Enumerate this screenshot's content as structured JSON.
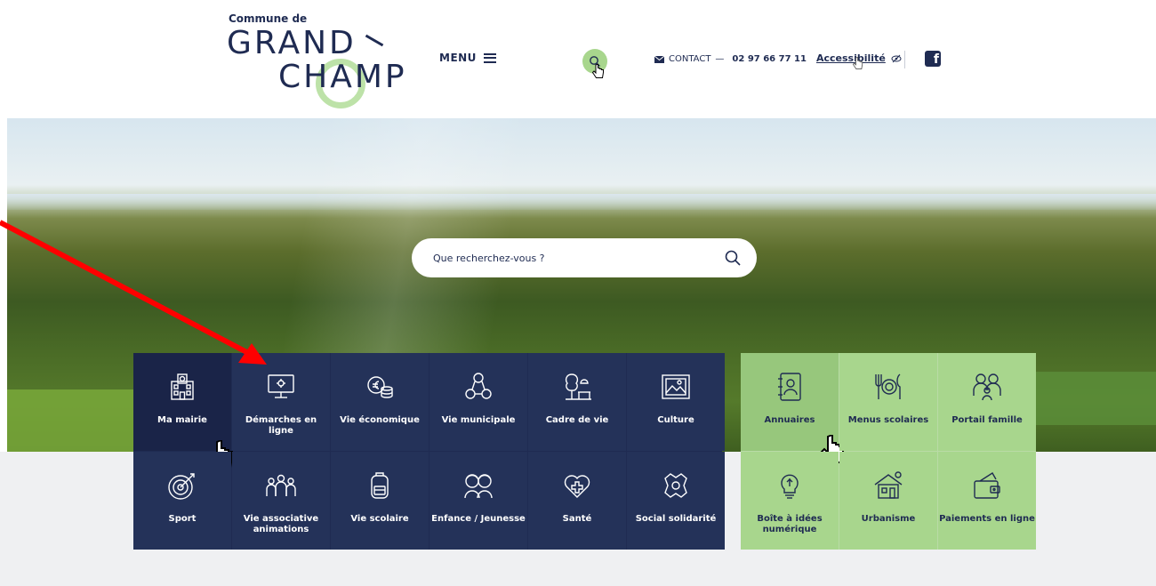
{
  "header": {
    "logo_small": "Commune de",
    "logo_line1": "GRAND",
    "logo_line2": "CHAMP",
    "menu_label": "MENU",
    "contact_label": "CONTACT",
    "contact_dash": "—",
    "phone": "02 97 66 77 11",
    "accessibility_label": "Accessibilité",
    "facebook_glyph": "f"
  },
  "hero": {
    "search_placeholder": "Que recherchez-vous ?"
  },
  "tiles_dark": [
    {
      "label": "Ma mairie",
      "icon": "town-hall-icon"
    },
    {
      "label": "Démarches en ligne",
      "icon": "computer-icon"
    },
    {
      "label": "Vie économique",
      "icon": "coins-icon"
    },
    {
      "label": "Vie municipale",
      "icon": "people-network-icon"
    },
    {
      "label": "Cadre de vie",
      "icon": "tree-icon"
    },
    {
      "label": "Culture",
      "icon": "painting-icon"
    },
    {
      "label": "Sport",
      "icon": "target-icon"
    },
    {
      "label": "Vie associative animations",
      "icon": "group-icon"
    },
    {
      "label": "Vie scolaire",
      "icon": "backpack-icon"
    },
    {
      "label": "Enfance / Jeunesse",
      "icon": "children-icon"
    },
    {
      "label": "Santé",
      "icon": "heart-cross-icon"
    },
    {
      "label": "Social solidarité",
      "icon": "hands-icon"
    }
  ],
  "tiles_green": [
    {
      "label": "Annuaires",
      "icon": "directory-icon"
    },
    {
      "label": "Menus scolaires",
      "icon": "cutlery-icon"
    },
    {
      "label": "Portail famille",
      "icon": "family-icon"
    },
    {
      "label": "Boîte à idées numérique",
      "icon": "lightbulb-icon"
    },
    {
      "label": "Urbanisme",
      "icon": "house-icon"
    },
    {
      "label": "Paiements en ligne",
      "icon": "wallet-icon"
    }
  ],
  "colors": {
    "navy": "#1f2b52",
    "green": "#a8d68d",
    "annotation": "#ff0000"
  }
}
